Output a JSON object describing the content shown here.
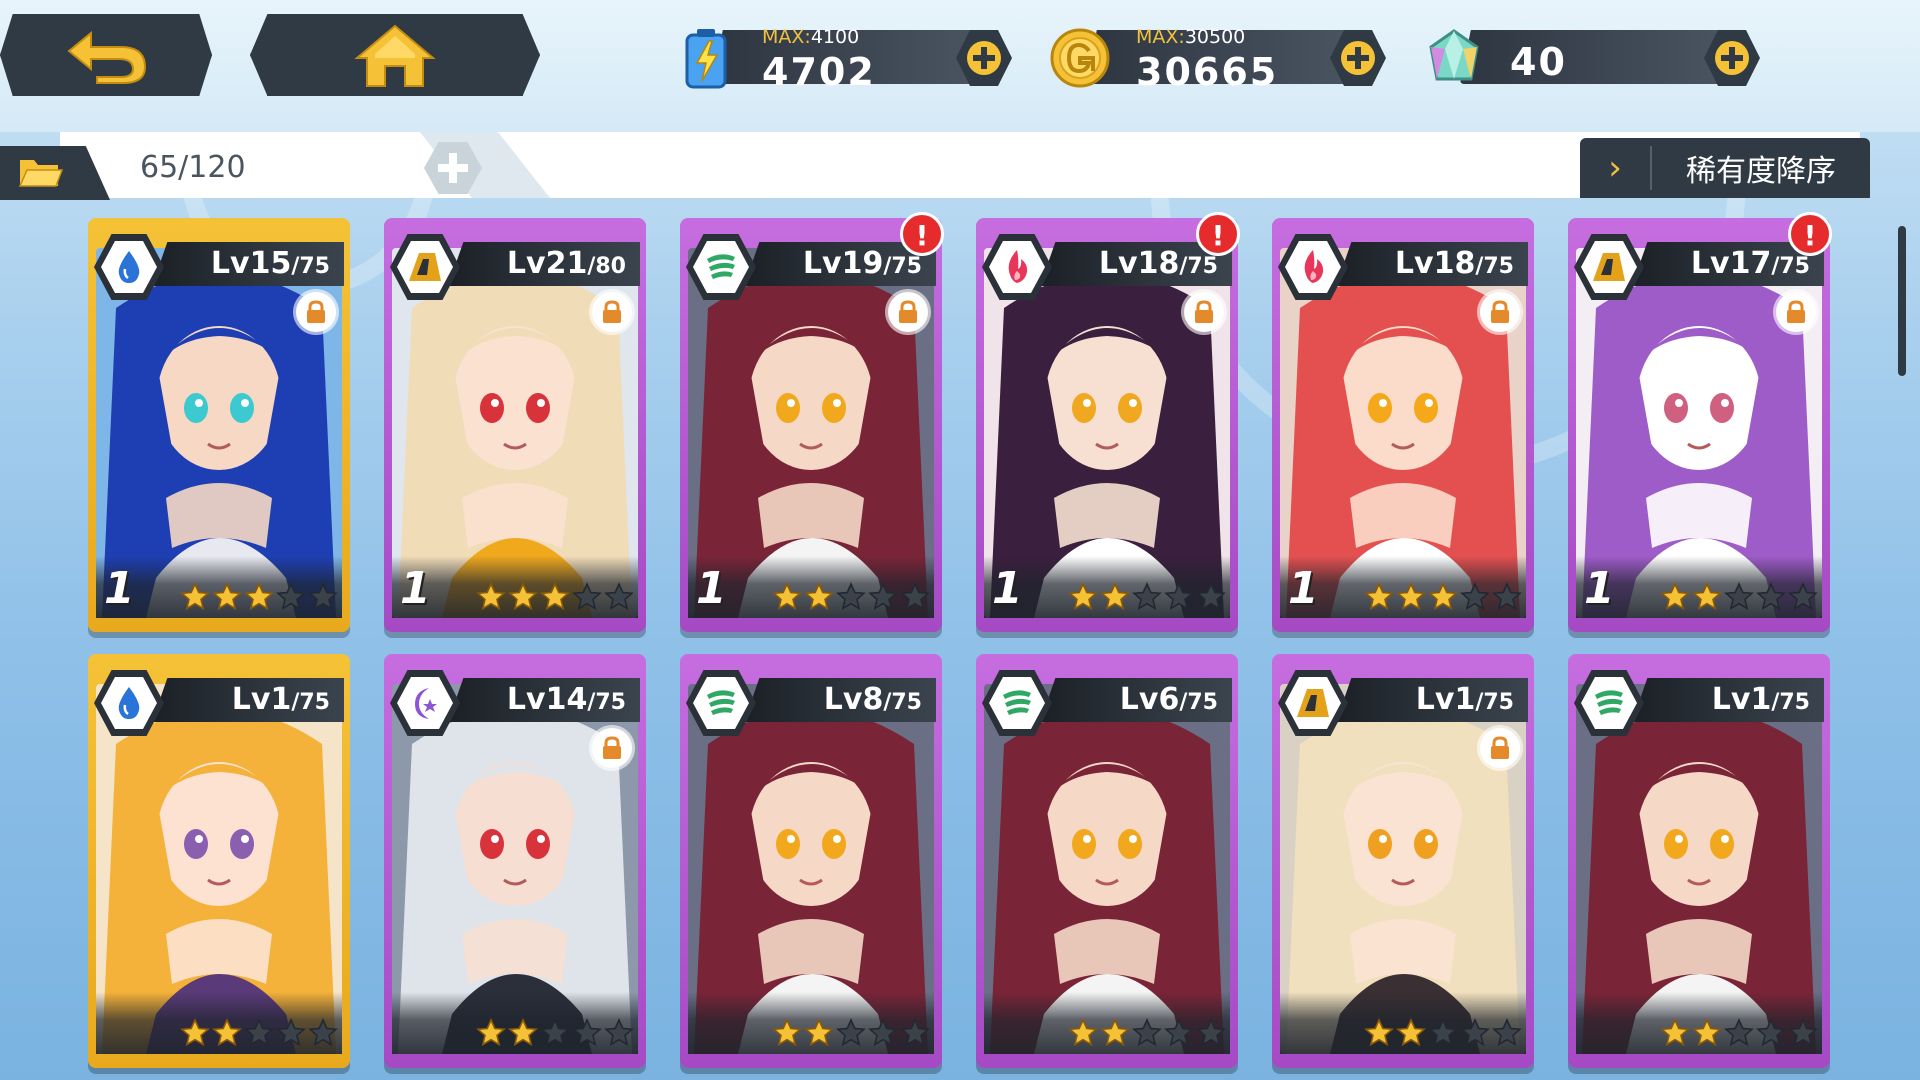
{
  "header": {
    "resources": [
      {
        "name": "stamina",
        "max_label": "MAX:",
        "max_value": "4100",
        "value": "4702"
      },
      {
        "name": "gold",
        "max_label": "MAX:",
        "max_value": "30500",
        "value": "30665"
      },
      {
        "name": "crystal",
        "value": "40"
      }
    ]
  },
  "filter": {
    "count": "65/120",
    "sort_label": "稀有度降序",
    "sort_chevron": "›"
  },
  "colors": {
    "gold_frame": "#f5c237",
    "purple_frame": "#c66de0",
    "dark_panel": "#2f3a44",
    "accent_yellow": "#f0c040",
    "alert_red": "#e52b2b"
  },
  "cards": [
    {
      "level": "Lv15",
      "max": "/75",
      "element": "water-icon",
      "frame": "gold",
      "quantity": "1",
      "stars": 3,
      "locked": true,
      "alert": false,
      "art": "blue"
    },
    {
      "level": "Lv21",
      "max": "/80",
      "element": "earth-icon",
      "frame": "purple",
      "quantity": "1",
      "stars": 3,
      "locked": true,
      "alert": false,
      "art": "blonde"
    },
    {
      "level": "Lv19",
      "max": "/75",
      "element": "wind-icon",
      "frame": "purple",
      "quantity": "1",
      "stars": 2,
      "locked": true,
      "alert": true,
      "art": "crimson"
    },
    {
      "level": "Lv18",
      "max": "/75",
      "element": "fire-icon",
      "frame": "purple",
      "quantity": "1",
      "stars": 2,
      "locked": true,
      "alert": true,
      "art": "dark"
    },
    {
      "level": "Lv18",
      "max": "/75",
      "element": "fire-icon",
      "frame": "purple",
      "quantity": "1",
      "stars": 3,
      "locked": true,
      "alert": false,
      "art": "red"
    },
    {
      "level": "Lv17",
      "max": "/75",
      "element": "earth-icon",
      "frame": "purple",
      "quantity": "1",
      "stars": 2,
      "locked": true,
      "alert": true,
      "art": "white"
    },
    {
      "level": "Lv1",
      "max": "/75",
      "element": "water-icon",
      "frame": "gold",
      "quantity": "",
      "stars": 2,
      "locked": false,
      "alert": false,
      "art": "orange"
    },
    {
      "level": "Lv14",
      "max": "/75",
      "element": "moon-icon",
      "frame": "purple",
      "quantity": "",
      "stars": 2,
      "locked": true,
      "alert": false,
      "art": "silver"
    },
    {
      "level": "Lv8",
      "max": "/75",
      "element": "wind-icon",
      "frame": "purple",
      "quantity": "",
      "stars": 2,
      "locked": false,
      "alert": false,
      "art": "crimson"
    },
    {
      "level": "Lv6",
      "max": "/75",
      "element": "wind-icon",
      "frame": "purple",
      "quantity": "",
      "stars": 2,
      "locked": false,
      "alert": false,
      "art": "crimson"
    },
    {
      "level": "Lv1",
      "max": "/75",
      "element": "earth-icon",
      "frame": "purple",
      "quantity": "",
      "stars": 2,
      "locked": true,
      "alert": false,
      "art": "pale"
    },
    {
      "level": "Lv1",
      "max": "/75",
      "element": "wind-icon",
      "frame": "purple",
      "quantity": "",
      "stars": 2,
      "locked": false,
      "alert": false,
      "art": "crimson"
    }
  ],
  "max_stars": 5
}
